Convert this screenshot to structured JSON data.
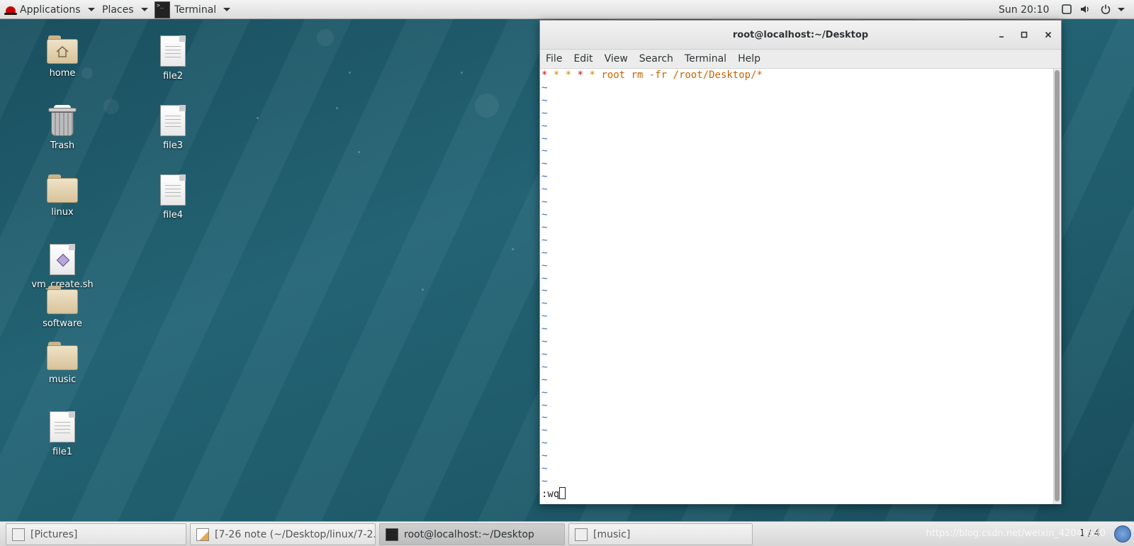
{
  "topbar": {
    "applications": "Applications",
    "places": "Places",
    "terminal_app": "Terminal",
    "clock": "Sun 20:10"
  },
  "desktop": {
    "icons": [
      {
        "label": "home",
        "kind": "home-folder-icon"
      },
      {
        "label": "Trash",
        "kind": "trash-icon"
      },
      {
        "label": "linux",
        "kind": "folder-icon"
      },
      {
        "label": "vm_create.sh",
        "kind": "script-icon"
      },
      {
        "label": "software",
        "kind": "folder-icon"
      },
      {
        "label": "music",
        "kind": "folder-icon"
      },
      {
        "label": "file1",
        "kind": "document-icon"
      },
      {
        "label": "file2",
        "kind": "document-icon"
      },
      {
        "label": "file3",
        "kind": "document-icon"
      },
      {
        "label": "file4",
        "kind": "document-icon"
      }
    ]
  },
  "window": {
    "title": "root@localhost:~/Desktop",
    "menu": [
      "File",
      "Edit",
      "View",
      "Search",
      "Terminal",
      "Help"
    ],
    "vim": {
      "stars": [
        "*",
        "*",
        "*",
        "*",
        "*"
      ],
      "command": "root rm -fr /root/Desktop/*",
      "tilde": "~",
      "tilde_rows": 32,
      "cmdline": ":wq"
    }
  },
  "taskbar": {
    "tasks": [
      {
        "label": "[Pictures]"
      },
      {
        "label": "[7-26 note (~/Desktop/linux/7-2..."
      },
      {
        "label": "root@localhost:~/Desktop"
      },
      {
        "label": "[music]"
      }
    ],
    "watermark": "https://blog.csdn.net/weixin_42049590",
    "pager": "1 / 4"
  },
  "colors": {
    "vim_tilde": "#3d6eb8",
    "vim_command": "#c86500",
    "vim_star_red": "#cc0000",
    "desktop_teal": "#1f5d6d"
  }
}
